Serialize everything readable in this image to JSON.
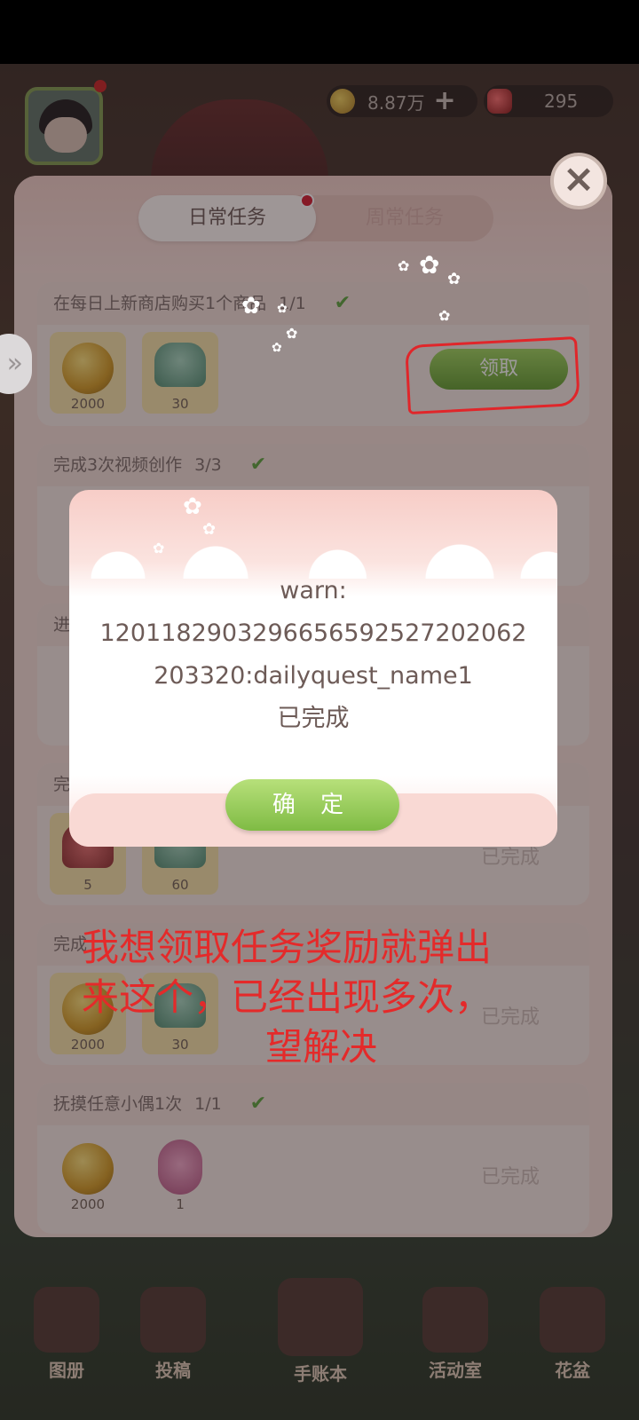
{
  "hud": {
    "coins": "8.87万",
    "coins_plus": "+",
    "gems": "295"
  },
  "tabs": {
    "daily": "日常任务",
    "weekly": "周常任务"
  },
  "tasks": [
    {
      "title": "在每日上新商店购买1个商品",
      "progress": "1/1",
      "rewards": [
        "2000",
        "30"
      ],
      "action": "领取"
    },
    {
      "title": "完成3次视频创作",
      "progress": "3/3"
    },
    {
      "title": "进",
      "progress": ""
    },
    {
      "title": "完",
      "progress": "",
      "rewards": [
        "5",
        "60"
      ],
      "status": "已完成"
    },
    {
      "title": "完成",
      "progress": "",
      "rewards": [
        "2000",
        "30"
      ],
      "status": "已完成"
    },
    {
      "title": "抚摸任意小偶1次",
      "progress": "1/1",
      "rewards": [
        "2000",
        "1"
      ],
      "status": "已完成"
    }
  ],
  "dialog": {
    "line1": "warn:",
    "line2": "1201182903296656592527202062",
    "line3": "203320:dailyquest_name1",
    "line4": "已完成",
    "ok": "确 定"
  },
  "annotation": {
    "line1": "我想领取任务奖励就弹出",
    "line2": "来这个，已经出现多次，",
    "line3": "望解决"
  },
  "nav": [
    "图册",
    "投稿",
    "手账本",
    "活动室",
    "花盆"
  ],
  "colors": {
    "annotation": "#e42a2a",
    "claim_green": "#7fbb44",
    "panel": "#f4dcd6"
  }
}
